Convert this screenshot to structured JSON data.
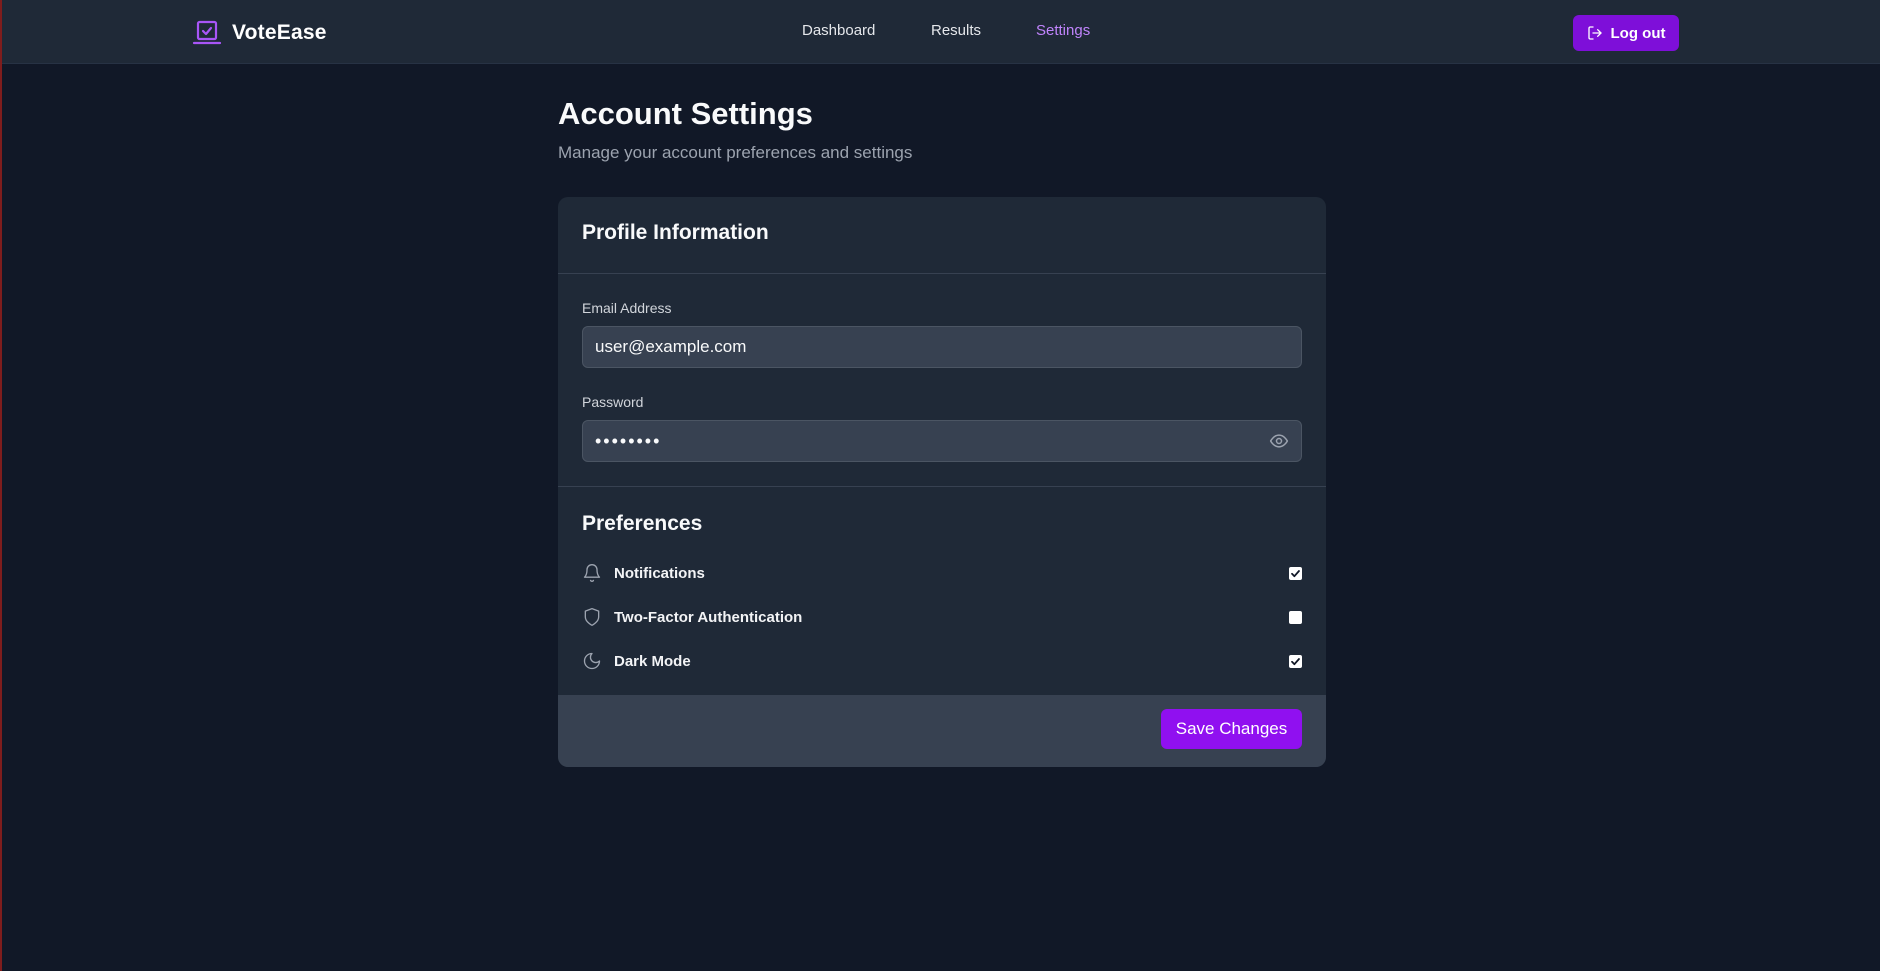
{
  "app": {
    "name": "VoteEase",
    "logo_icon": "vote-laptop-check-icon",
    "accent_color": "#a855f7",
    "button_color": "#9010f0"
  },
  "nav": {
    "items": [
      {
        "label": "Dashboard",
        "active": false
      },
      {
        "label": "Results",
        "active": false
      },
      {
        "label": "Settings",
        "active": true
      }
    ]
  },
  "header": {
    "logout_label": "Log out",
    "logout_icon": "log-out-icon"
  },
  "page": {
    "title": "Account Settings",
    "subtitle": "Manage your account preferences and settings"
  },
  "profile": {
    "title": "Profile Information",
    "email_label": "Email Address",
    "email_value": "user@example.com",
    "password_label": "Password",
    "password_value": "••••••••",
    "password_toggle_icon": "eye-icon"
  },
  "preferences": {
    "title": "Preferences",
    "items": [
      {
        "label": "Notifications",
        "icon": "bell-icon",
        "checked": true
      },
      {
        "label": "Two-Factor Authentication",
        "icon": "shield-icon",
        "checked": false
      },
      {
        "label": "Dark Mode",
        "icon": "moon-icon",
        "checked": true
      }
    ]
  },
  "footer": {
    "save_label": "Save Changes"
  }
}
